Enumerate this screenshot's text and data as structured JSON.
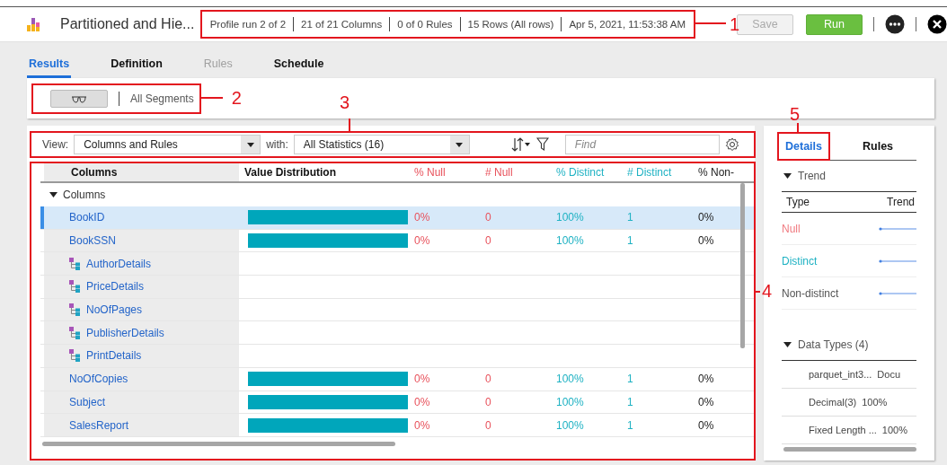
{
  "app": {
    "title": "Partitioned and Hie..."
  },
  "run_info": {
    "callout": "1",
    "items": [
      "Profile run 2 of 2",
      "21 of 21 Columns",
      "0 of 0 Rules",
      "15 Rows (All rows)",
      "Apr 5, 2021, 11:53:38 AM"
    ]
  },
  "actions": [
    {
      "label": "Save",
      "disabled": true
    },
    {
      "label": "Run",
      "disabled": false
    }
  ],
  "tabs": [
    {
      "label": "Results",
      "selected": true,
      "disabled": false
    },
    {
      "label": "Definition",
      "selected": false,
      "disabled": false
    },
    {
      "label": "Rules",
      "selected": false,
      "disabled": true
    },
    {
      "label": "Schedule",
      "selected": false,
      "disabled": false
    }
  ],
  "segments": {
    "callout": "2",
    "label": "All Segments"
  },
  "toolbar": {
    "callout": "3",
    "view_label": "View:",
    "view_value": "Columns and Rules",
    "with_label": "with:",
    "with_value": "All Statistics (16)",
    "find_placeholder": "Find"
  },
  "table": {
    "callout": "4",
    "columns": [
      {
        "label": "Columns",
        "color": "#111111"
      },
      {
        "label": "Value Distribution",
        "color": "#111111"
      },
      {
        "label": "% Null",
        "color": "#e8515b"
      },
      {
        "label": "# Null",
        "color": "#e8515b"
      },
      {
        "label": "% Distinct",
        "color": "#1fb2c3"
      },
      {
        "label": "# Distinct",
        "color": "#1fb2c3"
      },
      {
        "label": "% Non-",
        "color": "#222222"
      }
    ],
    "group": {
      "label": "Columns",
      "expanded": true
    },
    "rows": [
      {
        "name": "BookID",
        "kind": "field",
        "selected": true,
        "cells": [
          "0%",
          "0",
          "100%",
          "1",
          "0%"
        ]
      },
      {
        "name": "BookSSN",
        "kind": "field",
        "selected": false,
        "cells": [
          "0%",
          "0",
          "100%",
          "1",
          "0%"
        ]
      },
      {
        "name": "AuthorDetails",
        "kind": "struct",
        "selected": false
      },
      {
        "name": "PriceDetails",
        "kind": "struct",
        "selected": false
      },
      {
        "name": "NoOfPages",
        "kind": "struct",
        "selected": false
      },
      {
        "name": "PublisherDetails",
        "kind": "struct",
        "selected": false
      },
      {
        "name": "PrintDetails",
        "kind": "struct",
        "selected": false
      },
      {
        "name": "NoOfCopies",
        "kind": "field",
        "selected": false,
        "cells": [
          "0%",
          "0",
          "100%",
          "1",
          "0%"
        ]
      },
      {
        "name": "Subject",
        "kind": "field",
        "selected": false,
        "cells": [
          "0%",
          "0",
          "100%",
          "1",
          "0%"
        ]
      },
      {
        "name": "SalesReport",
        "kind": "field",
        "selected": false,
        "cells": [
          "0%",
          "0",
          "100%",
          "1",
          "0%"
        ]
      }
    ]
  },
  "details": {
    "callout": "5",
    "tabs": [
      {
        "label": "Details",
        "selected": true
      },
      {
        "label": "Rules",
        "selected": false
      }
    ],
    "trend": {
      "title": "Trend",
      "expanded": true,
      "headers": [
        "Type",
        "Trend"
      ],
      "rows": [
        {
          "label": "Null",
          "color": "#f07a80"
        },
        {
          "label": "Distinct",
          "color": "#1fb2c3"
        },
        {
          "label": "Non-distinct",
          "color": "#555555"
        }
      ]
    },
    "data_types": {
      "title": "Data Types (4)",
      "expanded": true,
      "rows": [
        {
          "name": "parquet_int3...",
          "value": "Docu"
        },
        {
          "name": "Decimal(3)",
          "value": "100%"
        },
        {
          "name": "Fixed Length ...",
          "value": "100%"
        }
      ]
    }
  }
}
